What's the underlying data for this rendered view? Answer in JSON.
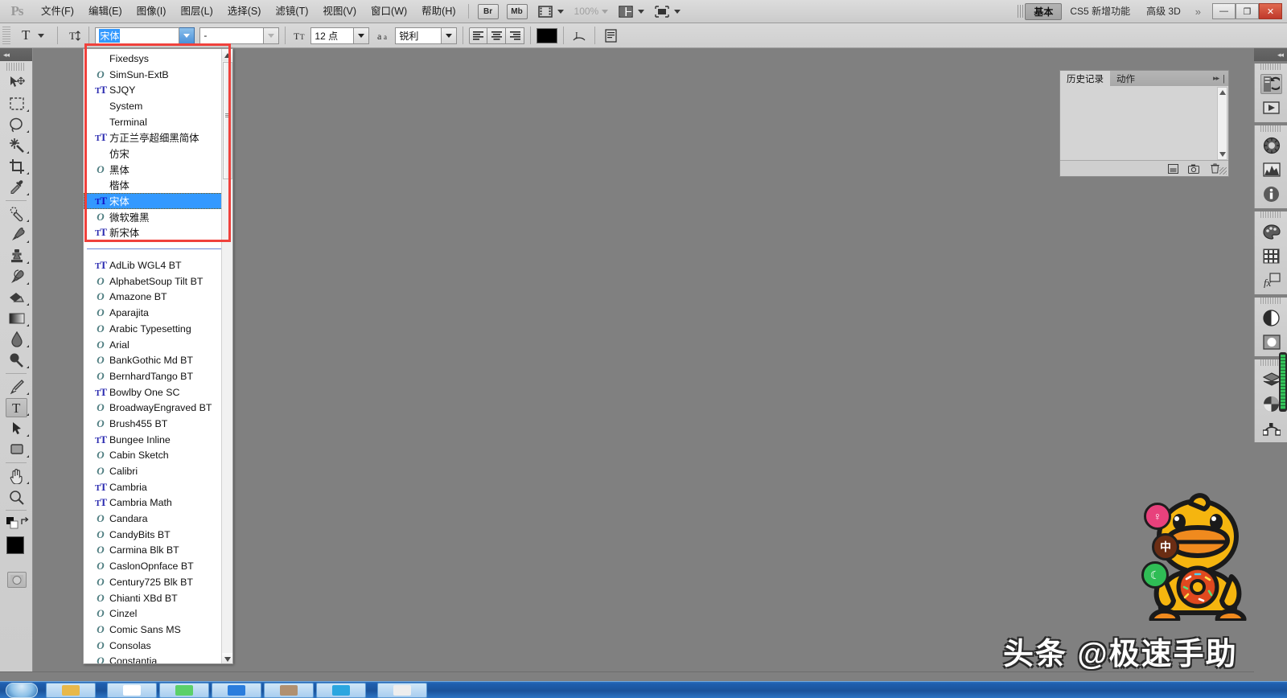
{
  "app": {
    "logo": "Ps",
    "zoom_level": "100%"
  },
  "menubar": {
    "items": [
      {
        "label": "文件(F)"
      },
      {
        "label": "编辑(E)"
      },
      {
        "label": "图像(I)"
      },
      {
        "label": "图层(L)"
      },
      {
        "label": "选择(S)"
      },
      {
        "label": "滤镜(T)"
      },
      {
        "label": "视图(V)"
      },
      {
        "label": "窗口(W)"
      },
      {
        "label": "帮助(H)"
      }
    ],
    "bridge_label": "Br",
    "minibridge_label": "Mb",
    "workspaces": [
      {
        "label": "基本",
        "active": true
      },
      {
        "label": "CS5 新增功能",
        "active": false
      },
      {
        "label": "高级 3D",
        "active": false
      }
    ],
    "workspace_overflow": "»",
    "window_buttons": {
      "minimize": "—",
      "maximize": "❐",
      "close": "✕"
    }
  },
  "options_bar": {
    "tool_letter": "T",
    "orientation_icon": "text-orientation-icon",
    "font_family_value": "宋体",
    "font_style_value": "-",
    "font_size_icon": "TT",
    "font_size_value": "12 点",
    "antialias_icon": "aa",
    "antialias_value": "锐利",
    "align_left": "align-left",
    "align_center": "align-center",
    "align_right": "align-right",
    "color_hex": "#000000",
    "warp_icon": "warp-text-icon",
    "panel_icon": "char-paragraph-panel-icon"
  },
  "toolbar": {
    "collapse_arrows": "◂◂",
    "tools": [
      {
        "name": "move-tool",
        "glyph": "move",
        "selected": false,
        "sub": false
      },
      {
        "name": "marquee-tool",
        "glyph": "marquee",
        "selected": false,
        "sub": true
      },
      {
        "name": "lasso-tool",
        "glyph": "lasso",
        "selected": false,
        "sub": true
      },
      {
        "name": "quick-select-tool",
        "glyph": "wand",
        "selected": false,
        "sub": true
      },
      {
        "name": "crop-tool",
        "glyph": "crop",
        "selected": false,
        "sub": true
      },
      {
        "name": "eyedropper-tool",
        "glyph": "eyedropper",
        "selected": false,
        "sub": true
      },
      {
        "name": "healing-brush-tool",
        "glyph": "heal",
        "selected": false,
        "sub": true
      },
      {
        "name": "brush-tool",
        "glyph": "brush",
        "selected": false,
        "sub": true
      },
      {
        "name": "clone-stamp-tool",
        "glyph": "stamp",
        "selected": false,
        "sub": true
      },
      {
        "name": "history-brush-tool",
        "glyph": "historybrush",
        "selected": false,
        "sub": true
      },
      {
        "name": "eraser-tool",
        "glyph": "eraser",
        "selected": false,
        "sub": true
      },
      {
        "name": "gradient-tool",
        "glyph": "gradient",
        "selected": false,
        "sub": true
      },
      {
        "name": "blur-tool",
        "glyph": "blur",
        "selected": false,
        "sub": true
      },
      {
        "name": "dodge-tool",
        "glyph": "dodge",
        "selected": false,
        "sub": true
      },
      {
        "name": "pen-tool",
        "glyph": "pen",
        "selected": false,
        "sub": true
      },
      {
        "name": "type-tool",
        "glyph": "type",
        "selected": true,
        "sub": true
      },
      {
        "name": "path-selection-tool",
        "glyph": "pathselect",
        "selected": false,
        "sub": true
      },
      {
        "name": "rectangle-tool",
        "glyph": "rect",
        "selected": false,
        "sub": true
      },
      {
        "name": "hand-tool",
        "glyph": "hand",
        "selected": false,
        "sub": true
      },
      {
        "name": "zoom-tool",
        "glyph": "zoom",
        "selected": false,
        "sub": false
      }
    ],
    "foreground_color": "#000000",
    "background_color": "#ffffff",
    "quickmask_name": "quick-mask-toggle"
  },
  "font_dropdown": {
    "highlight_box_color": "#f0413c",
    "recent_fonts": [
      {
        "name": "Fixedsys",
        "icon": "none"
      },
      {
        "name": "SimSun-ExtB",
        "icon": "opentype"
      },
      {
        "name": "SJQY",
        "icon": "truetype"
      },
      {
        "name": "System",
        "icon": "none"
      },
      {
        "name": "Terminal",
        "icon": "none"
      },
      {
        "name": "方正兰亭超细黑简体",
        "icon": "truetype"
      },
      {
        "name": "仿宋",
        "icon": "none"
      },
      {
        "name": "黑体",
        "icon": "opentype"
      },
      {
        "name": "楷体",
        "icon": "none"
      },
      {
        "name": "宋体",
        "icon": "truetype",
        "selected": true
      },
      {
        "name": "微软雅黑",
        "icon": "opentype"
      },
      {
        "name": "新宋体",
        "icon": "truetype"
      }
    ],
    "all_fonts": [
      {
        "name": "AdLib WGL4 BT",
        "icon": "truetype"
      },
      {
        "name": "AlphabetSoup Tilt BT",
        "icon": "opentype"
      },
      {
        "name": "Amazone BT",
        "icon": "opentype"
      },
      {
        "name": "Aparajita",
        "icon": "opentype"
      },
      {
        "name": "Arabic Typesetting",
        "icon": "opentype"
      },
      {
        "name": "Arial",
        "icon": "opentype"
      },
      {
        "name": "BankGothic Md BT",
        "icon": "opentype"
      },
      {
        "name": "BernhardTango BT",
        "icon": "opentype"
      },
      {
        "name": "Bowlby One SC",
        "icon": "truetype"
      },
      {
        "name": "BroadwayEngraved BT",
        "icon": "opentype"
      },
      {
        "name": "Brush455 BT",
        "icon": "opentype"
      },
      {
        "name": "Bungee Inline",
        "icon": "truetype"
      },
      {
        "name": "Cabin Sketch",
        "icon": "opentype"
      },
      {
        "name": "Calibri",
        "icon": "opentype"
      },
      {
        "name": "Cambria",
        "icon": "truetype"
      },
      {
        "name": "Cambria Math",
        "icon": "truetype"
      },
      {
        "name": "Candara",
        "icon": "opentype"
      },
      {
        "name": "CandyBits BT",
        "icon": "opentype"
      },
      {
        "name": "Carmina Blk BT",
        "icon": "opentype"
      },
      {
        "name": "CaslonOpnface BT",
        "icon": "opentype"
      },
      {
        "name": "Century725 Blk BT",
        "icon": "opentype"
      },
      {
        "name": "Chianti XBd BT",
        "icon": "opentype"
      },
      {
        "name": "Cinzel",
        "icon": "opentype"
      },
      {
        "name": "Comic Sans MS",
        "icon": "opentype"
      },
      {
        "name": "Consolas",
        "icon": "opentype"
      },
      {
        "name": "Constantia",
        "icon": "opentype"
      }
    ]
  },
  "history_panel": {
    "tabs": [
      {
        "label": "历史记录",
        "active": true
      },
      {
        "label": "动作",
        "active": false
      }
    ],
    "collapse_icon": "▸▸",
    "menu_icon": "panel-menu-icon",
    "footer_icons": [
      {
        "name": "new-document-from-state-icon",
        "glyph": "▣"
      },
      {
        "name": "new-snapshot-icon",
        "glyph": "◙"
      },
      {
        "name": "delete-state-icon",
        "glyph": "🗑"
      }
    ]
  },
  "icon_rail": {
    "collapse_arrows": "◂◂",
    "groups": [
      {
        "buttons": [
          {
            "name": "history-panel-icon",
            "glyph": "history",
            "selected": true
          },
          {
            "name": "actions-panel-icon",
            "glyph": "play",
            "selected": false
          }
        ]
      },
      {
        "buttons": [
          {
            "name": "navigator-panel-icon",
            "glyph": "nav",
            "selected": false
          },
          {
            "name": "histogram-panel-icon",
            "glyph": "histogram",
            "selected": false
          },
          {
            "name": "info-panel-icon",
            "glyph": "info",
            "selected": false
          }
        ]
      },
      {
        "buttons": [
          {
            "name": "color-panel-icon",
            "glyph": "palette",
            "selected": false
          },
          {
            "name": "swatches-panel-icon",
            "glyph": "swatches",
            "selected": false
          },
          {
            "name": "styles-panel-icon",
            "glyph": "fx",
            "selected": false
          }
        ]
      },
      {
        "buttons": [
          {
            "name": "adjustments-panel-icon",
            "glyph": "adjust",
            "selected": false
          },
          {
            "name": "masks-panel-icon",
            "glyph": "mask",
            "selected": false
          }
        ]
      },
      {
        "buttons": [
          {
            "name": "layers-panel-icon",
            "glyph": "layers",
            "selected": false
          },
          {
            "name": "channels-panel-icon",
            "glyph": "channels",
            "selected": false
          },
          {
            "name": "paths-panel-icon",
            "glyph": "paths",
            "selected": false
          }
        ]
      }
    ]
  },
  "watermark": {
    "text": "头条 @极速手助",
    "chips": [
      {
        "name": "chip-pink",
        "glyph": "♀",
        "color": "#e8417c"
      },
      {
        "name": "chip-brown",
        "glyph": "中",
        "color": "#6b2d13"
      },
      {
        "name": "chip-green",
        "glyph": "☾",
        "color": "#2fbd55"
      }
    ],
    "duck_name": "duck-mascot"
  },
  "taskbar": {
    "start_label": "start-orb",
    "items": [
      {
        "name": "taskbar-item-1",
        "color": "#e8b84a"
      },
      {
        "name": "taskbar-item-2",
        "color": "#ffffff"
      },
      {
        "name": "taskbar-item-3",
        "color": "#5bd06a"
      },
      {
        "name": "taskbar-item-4",
        "color": "#2a7ddd"
      },
      {
        "name": "taskbar-item-5",
        "color": "#b09070"
      },
      {
        "name": "taskbar-item-6",
        "color": "#2aa6e0"
      },
      {
        "name": "taskbar-item-7",
        "color": "#eeeeee"
      }
    ]
  }
}
